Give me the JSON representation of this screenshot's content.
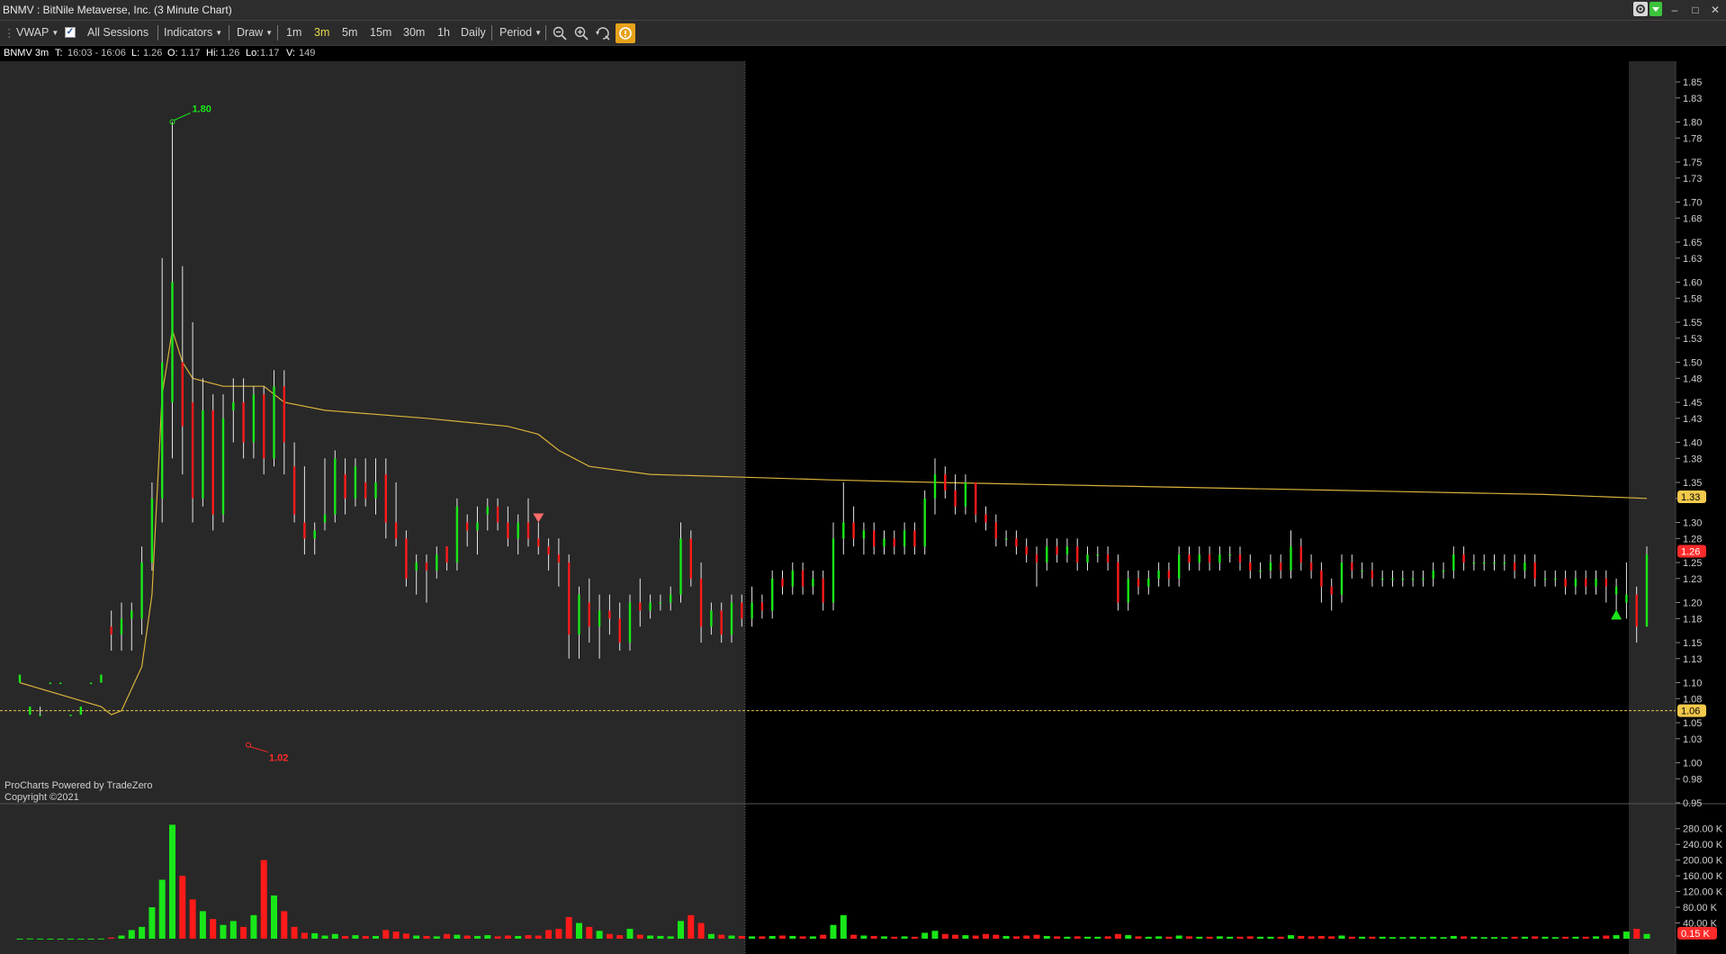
{
  "window": {
    "title": "BNMV : BitNile Metaverse, Inc. (3 Minute Chart)",
    "minimize": "–",
    "maximize": "□",
    "close": "✕"
  },
  "toolbar": {
    "vwap": "VWAP",
    "all_sessions": "All Sessions",
    "indicators": "Indicators",
    "draw": "Draw",
    "timeframes": [
      "1m",
      "3m",
      "5m",
      "15m",
      "30m",
      "1h",
      "Daily"
    ],
    "active_timeframe": "3m",
    "period": "Period",
    "icons": [
      "zoom-out-icon",
      "zoom-in-icon",
      "reset-zoom-icon",
      "highlight-icon"
    ]
  },
  "infobar": {
    "symbol": "BNMV 3m",
    "time_label": "T:",
    "time_value": "16:03 - 16:06",
    "last_label": "L:",
    "last_value": "1.26",
    "open_label": "O:",
    "open_value": "1.17",
    "high_label": "Hi:",
    "high_value": "1.26",
    "low_label": "Lo:",
    "low_value": "1.17",
    "volume_label": "V:",
    "volume_value": "149"
  },
  "footer": {
    "line1": "ProCharts Powered by TradeZero",
    "line2": "Copyright ©2021"
  },
  "colors": {
    "up": "#19e619",
    "down": "#ff1a1a",
    "vwap": "#d9b23c",
    "extended_session_bg": "#282828",
    "grid_line": "#2e2e2e",
    "active_tab": "#e9d94a",
    "last_price_badge": "#ff2a2a",
    "vwap_badge": "#f2c94c"
  },
  "chart_data": {
    "type": "candlestick",
    "symbol": "BNMV",
    "interval": "3 Minute",
    "price_axis": {
      "min": 0.95,
      "max": 1.87,
      "ticks": [
        "0.95",
        "0.98",
        "1.00",
        "1.03",
        "1.05",
        "1.08",
        "1.10",
        "1.13",
        "1.15",
        "1.18",
        "1.20",
        "1.23",
        "1.25",
        "1.28",
        "1.30",
        "1.33",
        "1.35",
        "1.38",
        "1.40",
        "1.43",
        "1.45",
        "1.48",
        "1.50",
        "1.53",
        "1.55",
        "1.58",
        "1.60",
        "1.63",
        "1.65",
        "1.68",
        "1.70",
        "1.73",
        "1.75",
        "1.78",
        "1.80",
        "1.83",
        "1.85"
      ]
    },
    "volume_axis": {
      "min": 0,
      "max": 300000,
      "ticks": [
        {
          "v": 40000,
          "t": "40.00 K"
        },
        {
          "v": 80000,
          "t": "80.00 K"
        },
        {
          "v": 120000,
          "t": "120.00 K"
        },
        {
          "v": 160000,
          "t": "160.00 K"
        },
        {
          "v": 200000,
          "t": "200.00 K"
        },
        {
          "v": 240000,
          "t": "240.00 K"
        },
        {
          "v": 280000,
          "t": "280.00 K"
        }
      ]
    },
    "price_badges": [
      {
        "label": "1.33",
        "price": 1.332,
        "kind": "vwap"
      },
      {
        "label": "1.26",
        "price": 1.264,
        "kind": "last"
      },
      {
        "label": "1.06",
        "price": 1.065,
        "kind": "ref"
      }
    ],
    "volume_badge": {
      "label": "0.15 K",
      "value": 150
    },
    "reference_line": 1.065,
    "annotations": [
      {
        "text": "1.80",
        "price": 1.8,
        "kind": "high"
      },
      {
        "text": "1.02",
        "price": 1.02,
        "kind": "low"
      }
    ],
    "candles": [
      [
        1.1,
        1.11,
        1.1,
        1.11,
        200
      ],
      [
        1.06,
        1.07,
        1.06,
        1.07,
        600
      ],
      [
        1.06,
        1.07,
        1.06,
        1.06,
        300
      ],
      [
        1.1,
        1.1,
        1.1,
        1.1,
        200
      ],
      [
        1.1,
        1.1,
        1.1,
        1.1,
        150
      ],
      [
        1.06,
        1.06,
        1.06,
        1.06,
        150
      ],
      [
        1.06,
        1.07,
        1.06,
        1.07,
        150
      ],
      [
        1.1,
        1.1,
        1.1,
        1.1,
        200
      ],
      [
        1.1,
        1.11,
        1.1,
        1.11,
        400
      ],
      [
        1.17,
        1.19,
        1.14,
        1.16,
        3000
      ],
      [
        1.16,
        1.2,
        1.14,
        1.18,
        8000
      ],
      [
        1.18,
        1.2,
        1.14,
        1.19,
        22000
      ],
      [
        1.18,
        1.27,
        1.16,
        1.25,
        30000
      ],
      [
        1.25,
        1.35,
        1.24,
        1.33,
        80000
      ],
      [
        1.33,
        1.63,
        1.3,
        1.5,
        150000
      ],
      [
        1.45,
        1.8,
        1.38,
        1.6,
        290000
      ],
      [
        1.5,
        1.62,
        1.36,
        1.42,
        160000
      ],
      [
        1.45,
        1.55,
        1.3,
        1.33,
        100000
      ],
      [
        1.33,
        1.48,
        1.32,
        1.44,
        70000
      ],
      [
        1.44,
        1.46,
        1.29,
        1.31,
        50000
      ],
      [
        1.31,
        1.46,
        1.3,
        1.43,
        35000
      ],
      [
        1.44,
        1.48,
        1.4,
        1.45,
        45000
      ],
      [
        1.45,
        1.48,
        1.38,
        1.4,
        30000
      ],
      [
        1.4,
        1.47,
        1.38,
        1.46,
        60000
      ],
      [
        1.46,
        1.47,
        1.36,
        1.38,
        200000
      ],
      [
        1.38,
        1.49,
        1.37,
        1.47,
        110000
      ],
      [
        1.47,
        1.49,
        1.36,
        1.4,
        70000
      ],
      [
        1.37,
        1.4,
        1.3,
        1.31,
        30000
      ],
      [
        1.3,
        1.37,
        1.26,
        1.28,
        15000
      ],
      [
        1.28,
        1.3,
        1.26,
        1.29,
        14000
      ],
      [
        1.3,
        1.38,
        1.29,
        1.31,
        8000
      ],
      [
        1.31,
        1.39,
        1.3,
        1.38,
        12000
      ],
      [
        1.36,
        1.38,
        1.31,
        1.33,
        7000
      ],
      [
        1.33,
        1.38,
        1.32,
        1.37,
        9000
      ],
      [
        1.35,
        1.38,
        1.32,
        1.33,
        7000
      ],
      [
        1.33,
        1.38,
        1.31,
        1.35,
        7000
      ],
      [
        1.36,
        1.38,
        1.28,
        1.3,
        22000
      ],
      [
        1.3,
        1.35,
        1.27,
        1.28,
        18000
      ],
      [
        1.28,
        1.29,
        1.22,
        1.23,
        13000
      ],
      [
        1.24,
        1.26,
        1.21,
        1.25,
        8000
      ],
      [
        1.25,
        1.26,
        1.2,
        1.24,
        7000
      ],
      [
        1.24,
        1.27,
        1.23,
        1.26,
        6000
      ],
      [
        1.27,
        1.27,
        1.24,
        1.25,
        12000
      ],
      [
        1.25,
        1.33,
        1.24,
        1.32,
        10000
      ],
      [
        1.3,
        1.31,
        1.27,
        1.29,
        8000
      ],
      [
        1.29,
        1.32,
        1.26,
        1.3,
        7000
      ],
      [
        1.31,
        1.33,
        1.29,
        1.32,
        9000
      ],
      [
        1.32,
        1.33,
        1.29,
        1.3,
        6000
      ],
      [
        1.3,
        1.32,
        1.27,
        1.28,
        8000
      ],
      [
        1.28,
        1.31,
        1.26,
        1.3,
        7000
      ],
      [
        1.3,
        1.33,
        1.27,
        1.28,
        9000
      ],
      [
        1.28,
        1.3,
        1.26,
        1.27,
        8000
      ],
      [
        1.27,
        1.28,
        1.24,
        1.26,
        22000
      ],
      [
        1.26,
        1.28,
        1.22,
        1.25,
        25000
      ],
      [
        1.25,
        1.26,
        1.13,
        1.16,
        55000
      ],
      [
        1.16,
        1.22,
        1.13,
        1.21,
        40000
      ],
      [
        1.2,
        1.23,
        1.15,
        1.17,
        30000
      ],
      [
        1.17,
        1.21,
        1.13,
        1.19,
        20000
      ],
      [
        1.19,
        1.21,
        1.16,
        1.18,
        12000
      ],
      [
        1.18,
        1.2,
        1.14,
        1.15,
        9000
      ],
      [
        1.15,
        1.21,
        1.14,
        1.2,
        25000
      ],
      [
        1.2,
        1.23,
        1.17,
        1.19,
        10000
      ],
      [
        1.19,
        1.21,
        1.18,
        1.2,
        8000
      ],
      [
        1.2,
        1.21,
        1.19,
        1.2,
        7000
      ],
      [
        1.2,
        1.22,
        1.19,
        1.21,
        6000
      ],
      [
        1.21,
        1.3,
        1.2,
        1.28,
        45000
      ],
      [
        1.28,
        1.29,
        1.22,
        1.23,
        60000
      ],
      [
        1.23,
        1.25,
        1.15,
        1.17,
        40000
      ],
      [
        1.17,
        1.2,
        1.16,
        1.19,
        12000
      ],
      [
        1.19,
        1.2,
        1.15,
        1.16,
        10000
      ],
      [
        1.16,
        1.21,
        1.15,
        1.2,
        8000
      ],
      [
        1.2,
        1.21,
        1.17,
        1.18,
        7000
      ],
      [
        1.18,
        1.22,
        1.17,
        1.2,
        6000
      ],
      [
        1.2,
        1.21,
        1.18,
        1.19,
        6000
      ],
      [
        1.19,
        1.24,
        1.18,
        1.23,
        7000
      ],
      [
        1.23,
        1.24,
        1.21,
        1.22,
        8000
      ],
      [
        1.22,
        1.25,
        1.21,
        1.24,
        7000
      ],
      [
        1.24,
        1.25,
        1.21,
        1.22,
        6000
      ],
      [
        1.22,
        1.24,
        1.21,
        1.23,
        6000
      ],
      [
        1.23,
        1.24,
        1.19,
        1.2,
        10000
      ],
      [
        1.2,
        1.3,
        1.19,
        1.28,
        35000
      ],
      [
        1.28,
        1.35,
        1.26,
        1.3,
        60000
      ],
      [
        1.3,
        1.32,
        1.27,
        1.28,
        10000
      ],
      [
        1.28,
        1.3,
        1.26,
        1.29,
        8000
      ],
      [
        1.29,
        1.3,
        1.26,
        1.27,
        7000
      ],
      [
        1.27,
        1.29,
        1.26,
        1.28,
        6000
      ],
      [
        1.28,
        1.29,
        1.26,
        1.27,
        5000
      ],
      [
        1.27,
        1.3,
        1.26,
        1.29,
        6000
      ],
      [
        1.29,
        1.3,
        1.26,
        1.27,
        5000
      ],
      [
        1.27,
        1.34,
        1.26,
        1.33,
        15000
      ],
      [
        1.33,
        1.38,
        1.31,
        1.36,
        20000
      ],
      [
        1.36,
        1.37,
        1.33,
        1.34,
        12000
      ],
      [
        1.34,
        1.36,
        1.31,
        1.32,
        10000
      ],
      [
        1.32,
        1.36,
        1.31,
        1.35,
        9000
      ],
      [
        1.35,
        1.35,
        1.3,
        1.31,
        8000
      ],
      [
        1.31,
        1.32,
        1.29,
        1.3,
        12000
      ],
      [
        1.3,
        1.31,
        1.27,
        1.28,
        10000
      ],
      [
        1.28,
        1.29,
        1.27,
        1.28,
        7000
      ],
      [
        1.28,
        1.29,
        1.26,
        1.27,
        6000
      ],
      [
        1.27,
        1.28,
        1.25,
        1.26,
        8000
      ],
      [
        1.26,
        1.27,
        1.22,
        1.25,
        10000
      ],
      [
        1.25,
        1.28,
        1.24,
        1.27,
        7000
      ],
      [
        1.27,
        1.28,
        1.25,
        1.26,
        6000
      ],
      [
        1.26,
        1.28,
        1.25,
        1.27,
        5000
      ],
      [
        1.27,
        1.28,
        1.24,
        1.25,
        6000
      ],
      [
        1.25,
        1.27,
        1.24,
        1.26,
        5000
      ],
      [
        1.26,
        1.27,
        1.25,
        1.26,
        5000
      ],
      [
        1.26,
        1.27,
        1.24,
        1.25,
        6000
      ],
      [
        1.25,
        1.26,
        1.19,
        1.2,
        12000
      ],
      [
        1.2,
        1.24,
        1.19,
        1.23,
        9000
      ],
      [
        1.23,
        1.24,
        1.21,
        1.22,
        6000
      ],
      [
        1.22,
        1.24,
        1.21,
        1.23,
        5000
      ],
      [
        1.23,
        1.25,
        1.22,
        1.24,
        6000
      ],
      [
        1.24,
        1.25,
        1.22,
        1.23,
        5000
      ],
      [
        1.23,
        1.27,
        1.22,
        1.26,
        8000
      ],
      [
        1.26,
        1.27,
        1.24,
        1.25,
        6000
      ],
      [
        1.25,
        1.27,
        1.24,
        1.26,
        5000
      ],
      [
        1.26,
        1.27,
        1.24,
        1.25,
        5000
      ],
      [
        1.25,
        1.27,
        1.24,
        1.26,
        6000
      ],
      [
        1.26,
        1.27,
        1.25,
        1.26,
        5000
      ],
      [
        1.26,
        1.27,
        1.24,
        1.25,
        5000
      ],
      [
        1.25,
        1.26,
        1.23,
        1.24,
        6000
      ],
      [
        1.24,
        1.25,
        1.23,
        1.24,
        5000
      ],
      [
        1.24,
        1.26,
        1.23,
        1.25,
        5000
      ],
      [
        1.25,
        1.26,
        1.23,
        1.24,
        5000
      ],
      [
        1.24,
        1.29,
        1.23,
        1.27,
        9000
      ],
      [
        1.27,
        1.28,
        1.24,
        1.25,
        7000
      ],
      [
        1.25,
        1.26,
        1.23,
        1.24,
        6000
      ],
      [
        1.24,
        1.25,
        1.2,
        1.22,
        7000
      ],
      [
        1.22,
        1.23,
        1.19,
        1.21,
        6000
      ],
      [
        1.21,
        1.26,
        1.2,
        1.25,
        8000
      ],
      [
        1.25,
        1.26,
        1.23,
        1.24,
        5000
      ],
      [
        1.24,
        1.25,
        1.23,
        1.24,
        5000
      ],
      [
        1.24,
        1.25,
        1.22,
        1.23,
        5000
      ],
      [
        1.23,
        1.24,
        1.22,
        1.23,
        5000
      ],
      [
        1.23,
        1.24,
        1.22,
        1.23,
        4000
      ],
      [
        1.23,
        1.24,
        1.22,
        1.23,
        4000
      ],
      [
        1.23,
        1.24,
        1.22,
        1.23,
        5000
      ],
      [
        1.23,
        1.24,
        1.22,
        1.23,
        4000
      ],
      [
        1.23,
        1.25,
        1.22,
        1.24,
        5000
      ],
      [
        1.24,
        1.25,
        1.23,
        1.24,
        4000
      ],
      [
        1.24,
        1.27,
        1.23,
        1.26,
        7000
      ],
      [
        1.26,
        1.27,
        1.24,
        1.25,
        6000
      ],
      [
        1.25,
        1.26,
        1.24,
        1.25,
        5000
      ],
      [
        1.25,
        1.26,
        1.24,
        1.25,
        4000
      ],
      [
        1.25,
        1.26,
        1.24,
        1.25,
        4000
      ],
      [
        1.25,
        1.26,
        1.24,
        1.25,
        4000
      ],
      [
        1.25,
        1.26,
        1.23,
        1.24,
        5000
      ],
      [
        1.24,
        1.26,
        1.23,
        1.25,
        5000
      ],
      [
        1.25,
        1.26,
        1.22,
        1.23,
        6000
      ],
      [
        1.23,
        1.24,
        1.22,
        1.23,
        5000
      ],
      [
        1.23,
        1.24,
        1.22,
        1.23,
        4000
      ],
      [
        1.23,
        1.24,
        1.21,
        1.22,
        5000
      ],
      [
        1.22,
        1.24,
        1.21,
        1.23,
        5000
      ],
      [
        1.23,
        1.24,
        1.21,
        1.22,
        5000
      ],
      [
        1.22,
        1.24,
        1.21,
        1.23,
        6000
      ],
      [
        1.23,
        1.24,
        1.2,
        1.22,
        8000
      ],
      [
        1.21,
        1.23,
        1.19,
        1.22,
        9000
      ],
      [
        1.2,
        1.25,
        1.18,
        1.21,
        18000
      ],
      [
        1.21,
        1.22,
        1.15,
        1.17,
        25000
      ],
      [
        1.17,
        1.27,
        1.17,
        1.26,
        12000
      ]
    ],
    "vwap": [
      [
        0,
        1.1
      ],
      [
        8,
        1.07
      ],
      [
        9,
        1.06
      ],
      [
        10,
        1.065
      ],
      [
        12,
        1.12
      ],
      [
        13,
        1.21
      ],
      [
        14,
        1.46
      ],
      [
        15,
        1.54
      ],
      [
        16,
        1.5
      ],
      [
        17,
        1.48
      ],
      [
        20,
        1.47
      ],
      [
        24,
        1.47
      ],
      [
        26,
        1.45
      ],
      [
        30,
        1.44
      ],
      [
        40,
        1.43
      ],
      [
        48,
        1.42
      ],
      [
        51,
        1.41
      ],
      [
        53,
        1.39
      ],
      [
        56,
        1.37
      ],
      [
        62,
        1.36
      ],
      [
        70,
        1.357
      ],
      [
        80,
        1.353
      ],
      [
        90,
        1.35
      ],
      [
        110,
        1.345
      ],
      [
        130,
        1.34
      ],
      [
        150,
        1.335
      ],
      [
        160,
        1.33
      ]
    ],
    "markers": [
      {
        "index": 51,
        "type": "sell-arrow"
      },
      {
        "index": 157,
        "type": "buy-arrow"
      }
    ]
  }
}
